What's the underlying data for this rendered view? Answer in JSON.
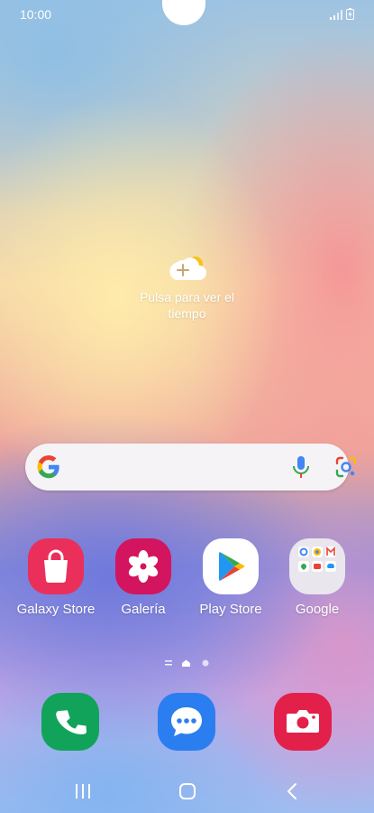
{
  "status_bar": {
    "time": "10:00"
  },
  "weather_widget": {
    "text": "Pulsa para ver el tiempo"
  },
  "search_bar": {
    "icons": [
      "google-g-icon",
      "microphone-icon",
      "google-lens-icon"
    ]
  },
  "apps": [
    {
      "label": "Galaxy Store",
      "icon": "galaxy-store-icon",
      "color": "#e8335e"
    },
    {
      "label": "Galería",
      "icon": "gallery-icon",
      "color": "#d4135e"
    },
    {
      "label": "Play Store",
      "icon": "play-store-icon",
      "color": "#ffffff"
    },
    {
      "label": "Google",
      "icon": "google-folder-icon",
      "color": "#e9e6ee"
    }
  ],
  "dock": [
    {
      "icon": "phone-icon",
      "color": "#11a35a"
    },
    {
      "icon": "messages-icon",
      "color": "#2b7ef0"
    },
    {
      "icon": "camera-icon",
      "color": "#e3204a"
    }
  ],
  "page_indicator": {
    "pages": 3,
    "current": 2
  },
  "navigation_bar": {
    "buttons": [
      "recents-button",
      "home-button",
      "back-button"
    ]
  }
}
